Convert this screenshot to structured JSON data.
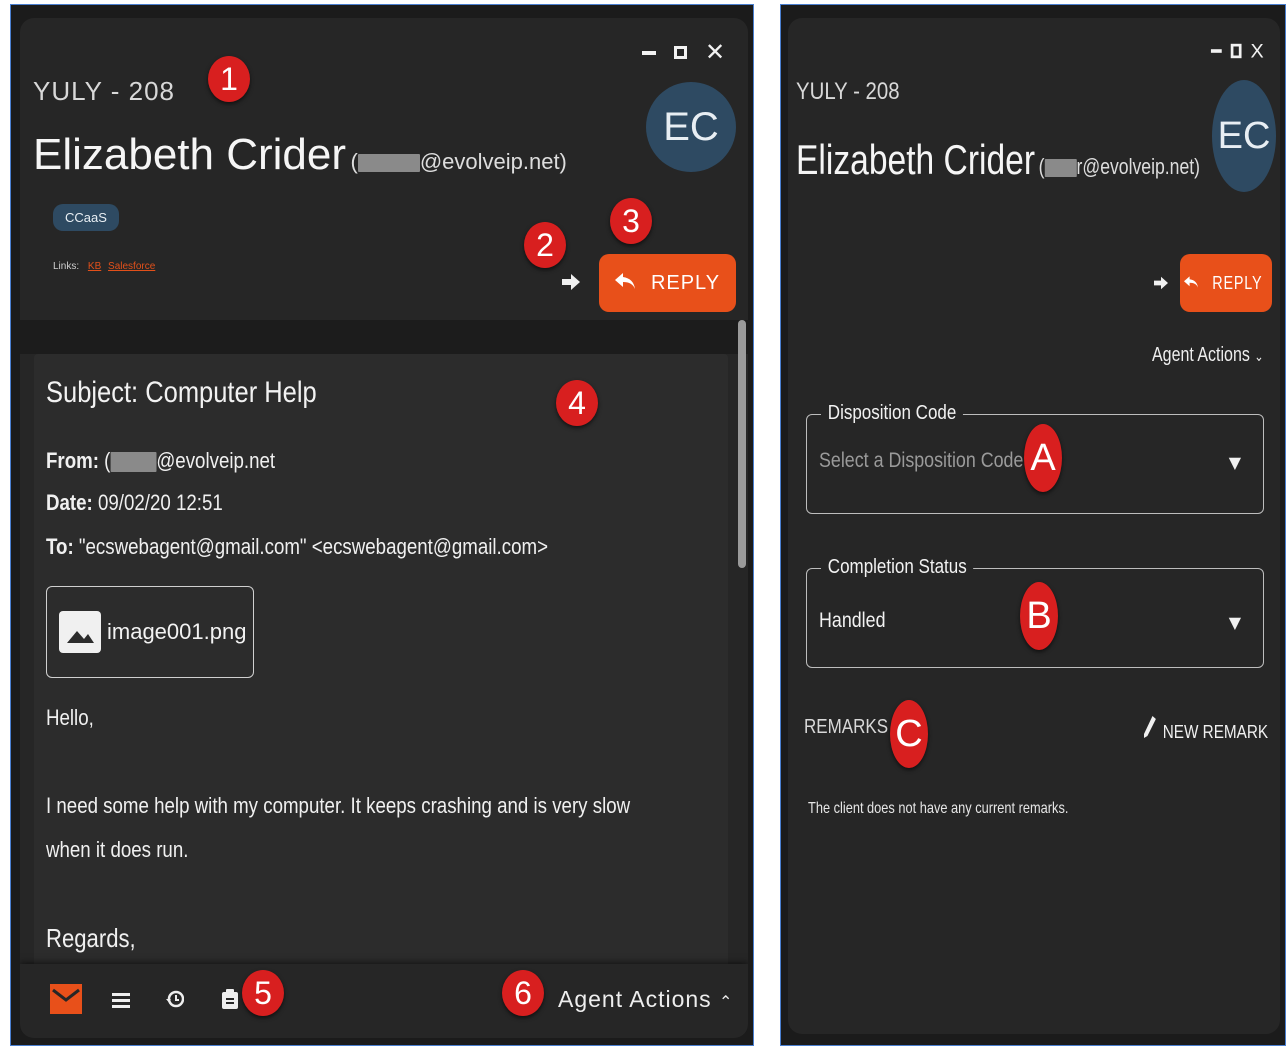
{
  "left": {
    "queue": "YULY - 208",
    "customer_name": "Elizabeth Crider",
    "customer_email_open": "(",
    "customer_email_domain": "@evolveip.net)",
    "avatar_initials": "EC",
    "tag": "CCaaS",
    "links_label": "Links:",
    "links": [
      "KB",
      "Salesforce"
    ],
    "reply_label": "REPLY",
    "email": {
      "subject": "Subject: Computer Help",
      "from_label": "From:",
      "from_value_open": "(",
      "from_value_domain": "@evolveip.net",
      "date_label": "Date:",
      "date_value": "09/02/20 12:51",
      "to_label": "To:",
      "to_value": "\"ecswebagent@gmail.com\" <ecswebagent@gmail.com>",
      "attachment": "image001.png",
      "greeting": "Hello,",
      "body_line1": "I need some help with my computer.  It keeps crashing and is very slow",
      "body_line2": "when it does run.",
      "closing": "Regards,"
    },
    "footer": {
      "agent_actions_label": "Agent Actions"
    },
    "callouts": [
      "1",
      "2",
      "3",
      "4",
      "5",
      "6"
    ]
  },
  "right": {
    "queue": "YULY - 208",
    "customer_name": "Elizabeth Crider",
    "customer_email_open": "(",
    "customer_email_domain": "r@evolveip.net)",
    "avatar_initials": "EC",
    "reply_label": "REPLY",
    "agent_actions_label": "Agent Actions",
    "disposition": {
      "legend": "Disposition Code",
      "placeholder": "Select a Disposition Code"
    },
    "completion": {
      "legend": "Completion Status",
      "value": "Handled"
    },
    "remarks_label": "REMARKS",
    "new_remark_label": "NEW REMARK",
    "no_remarks_text": "The client does not have any current remarks.",
    "callouts": [
      "A",
      "B",
      "C"
    ]
  },
  "colors": {
    "accent": "#e8501a",
    "avatar_bg": "#2e4a62",
    "panel_bg": "#262626",
    "callout": "#d81f1f",
    "frame_border": "#4a7fd0"
  },
  "icons": [
    "minimize-icon",
    "maximize-icon",
    "close-icon",
    "forward-icon",
    "reply-icon",
    "image-icon",
    "mail-icon",
    "list-icon",
    "history-icon",
    "clipboard-icon",
    "chevron-up-icon",
    "chevron-down-icon",
    "dropdown-arrow-icon",
    "pencil-icon"
  ]
}
